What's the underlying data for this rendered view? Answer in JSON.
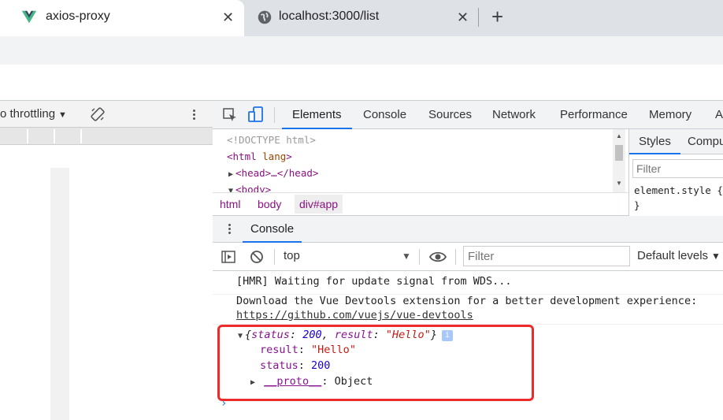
{
  "browser": {
    "tabs": [
      {
        "title": "axios-proxy",
        "favicon": "vue-logo-icon",
        "active": true
      },
      {
        "title": "localhost:3000/list",
        "favicon": "globe-icon",
        "active": false
      }
    ],
    "close_symbol": "✕",
    "new_tab_symbol": "+"
  },
  "device_toolbar": {
    "throttling_label": "o throttling",
    "dropdown_arrow": "▼"
  },
  "devtools": {
    "tabs": [
      "Elements",
      "Console",
      "Sources",
      "Network",
      "Performance",
      "Memory",
      "A"
    ],
    "active_tab": "Elements",
    "elements_lines": {
      "doctype": "<!DOCTYPE html>",
      "html_open": "<html ",
      "html_attr": "lang",
      "html_close": ">",
      "head": "<head>…</head>",
      "body": "<body>"
    },
    "breadcrumbs": [
      "html",
      "body",
      "div#app"
    ],
    "styles": {
      "tabs": [
        "Styles",
        "Compu"
      ],
      "filter_placeholder": "Filter",
      "rule": "element.style {",
      "rule_close": "}"
    },
    "drawer": {
      "tab": "Console"
    },
    "console_toolbar": {
      "context": "top",
      "filter_placeholder": "Filter",
      "levels": "Default levels"
    },
    "messages": {
      "hmr": "[HMR] Waiting for update signal from WDS...",
      "devtools_text": "Download the Vue Devtools extension for a better development experience:",
      "devtools_link": "https://github.com/vuejs/vue-devtools",
      "object": {
        "open_brace": "{",
        "k1": "status",
        "v1": "200",
        "k2": "result",
        "v2": "\"Hello\"",
        "close_brace": "}",
        "badge": "i",
        "prop_result_key": "result",
        "prop_result_val": "\"Hello\"",
        "prop_status_key": "status",
        "prop_status_val": "200",
        "proto_key": "__proto__",
        "proto_val": ": Object"
      },
      "prompt": "›"
    }
  },
  "colors": {
    "accent": "#1a73e8",
    "highlight": "#ee2b2b",
    "tag": "#881280",
    "string": "#c41a16",
    "number": "#1c00cf"
  }
}
